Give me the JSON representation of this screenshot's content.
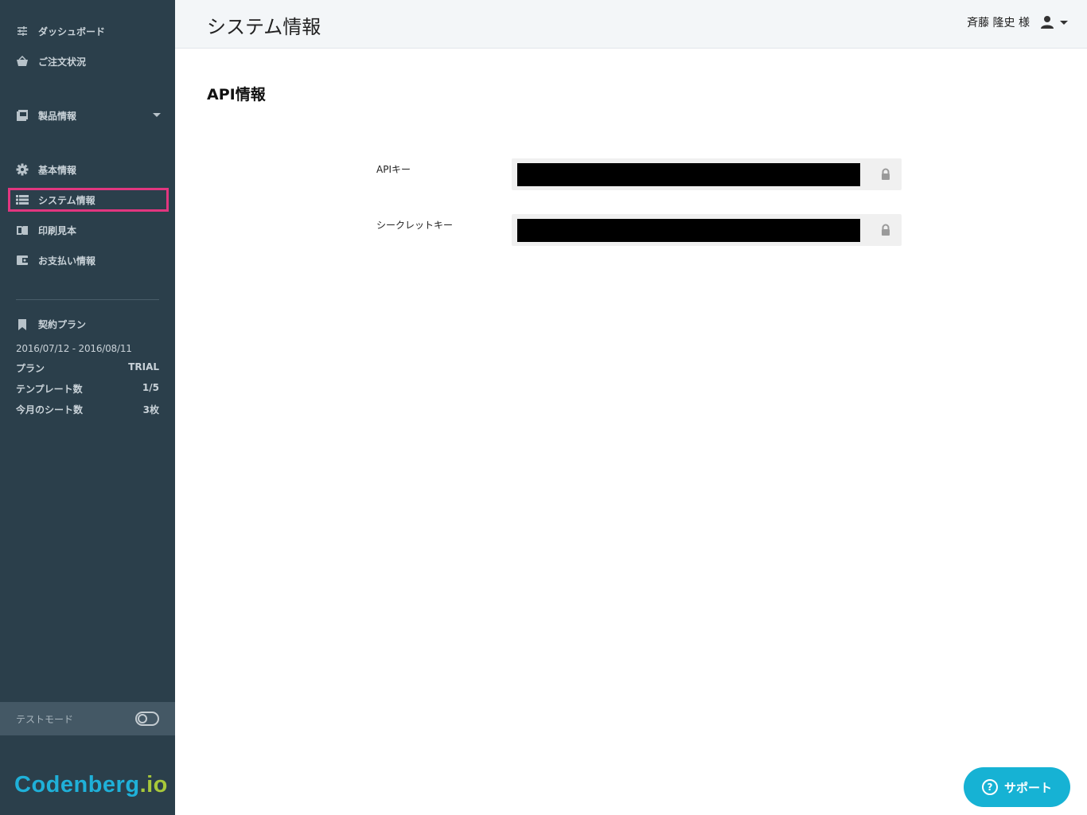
{
  "sidebar": {
    "nav": [
      {
        "label": "ダッシュボード",
        "icon": "sliders-icon"
      },
      {
        "label": "ご注文状況",
        "icon": "basket-icon"
      },
      {
        "label": "製品情報",
        "icon": "pdf-icon"
      },
      {
        "label": "基本情報",
        "icon": "gear-icon"
      },
      {
        "label": "システム情報",
        "icon": "list-icon",
        "active": true
      },
      {
        "label": "印刷見本",
        "icon": "book-icon"
      },
      {
        "label": "お支払い情報",
        "icon": "wallet-icon"
      }
    ],
    "plan": {
      "title": "契約プラン",
      "dates": "2016/07/12 - 2016/08/11",
      "rows": [
        {
          "label": "プラン",
          "value": "TRIAL"
        },
        {
          "label": "テンプレート数",
          "value": "1/5"
        },
        {
          "label": "今月のシート数",
          "value": "3枚"
        }
      ]
    },
    "test_mode_label": "テストモード",
    "logo_main": "Codenberg",
    "logo_suffix": ".io"
  },
  "header": {
    "title": "システム情報",
    "user_name": "斉藤 隆史 様"
  },
  "main": {
    "section_title": "API情報",
    "fields": [
      {
        "label": "APIキー"
      },
      {
        "label": "シークレットキー"
      }
    ]
  },
  "support_label": "サポート",
  "colors": {
    "sidebar_bg": "#2b3f4b",
    "active_border": "#e2367f",
    "support_bg": "#16b2d4",
    "logo_blue": "#1fb0d8",
    "logo_green": "#a8c83a"
  }
}
